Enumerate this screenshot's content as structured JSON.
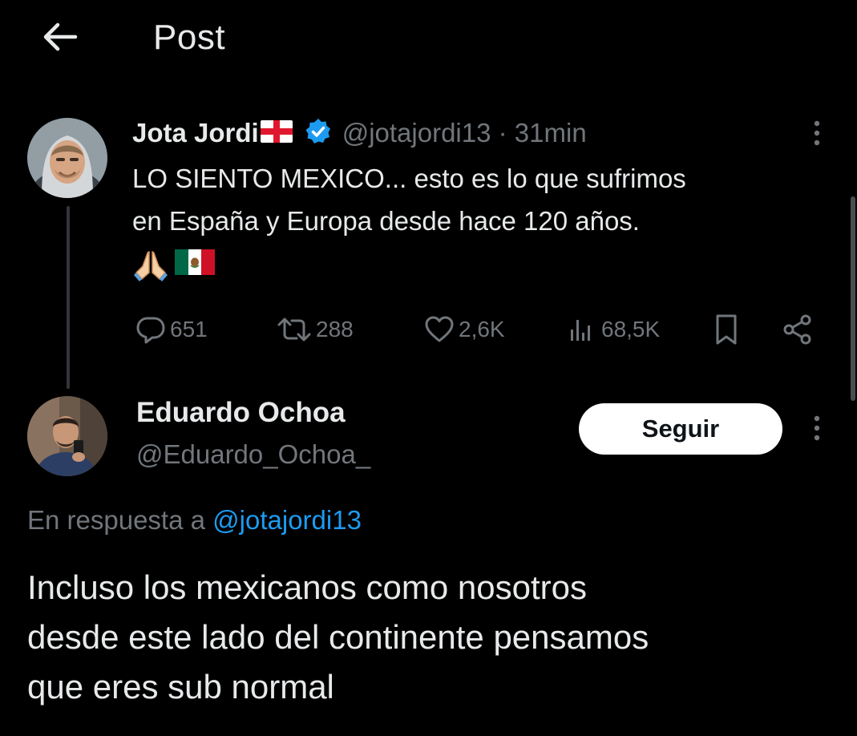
{
  "header": {
    "title": "Post",
    "back_icon": "arrow-left-icon"
  },
  "original_tweet": {
    "display_name": "Jota Jordi",
    "name_flag": "england-flag-icon",
    "verified_icon": "verified-badge-icon",
    "handle_time": "@jotajordi13 · 31min",
    "text_line1": "LO SIENTO MEXICO... esto es lo que sufrimos",
    "text_line2": "en España y Europa desde hace 120 años.",
    "emojis": [
      "folded-hands-icon",
      "mexico-flag-icon"
    ],
    "stats": {
      "replies": "651",
      "retweets": "288",
      "likes": "2,6K",
      "views": "68,5K"
    }
  },
  "reply_tweet": {
    "display_name": "Eduardo Ochoa",
    "handle": "@Eduardo_Ochoa_",
    "follow_label": "Seguir",
    "reply_prefix": "En respuesta a ",
    "reply_mention": "@jotajordi13",
    "text_line1": "Incluso los mexicanos como nosotros",
    "text_line2": "desde este lado del continente pensamos",
    "text_line3": "que eres sub normal"
  },
  "colors": {
    "background": "#000000",
    "primary_text": "#e7e9ea",
    "secondary_text": "#71767b",
    "accent": "#1d9bf0"
  }
}
